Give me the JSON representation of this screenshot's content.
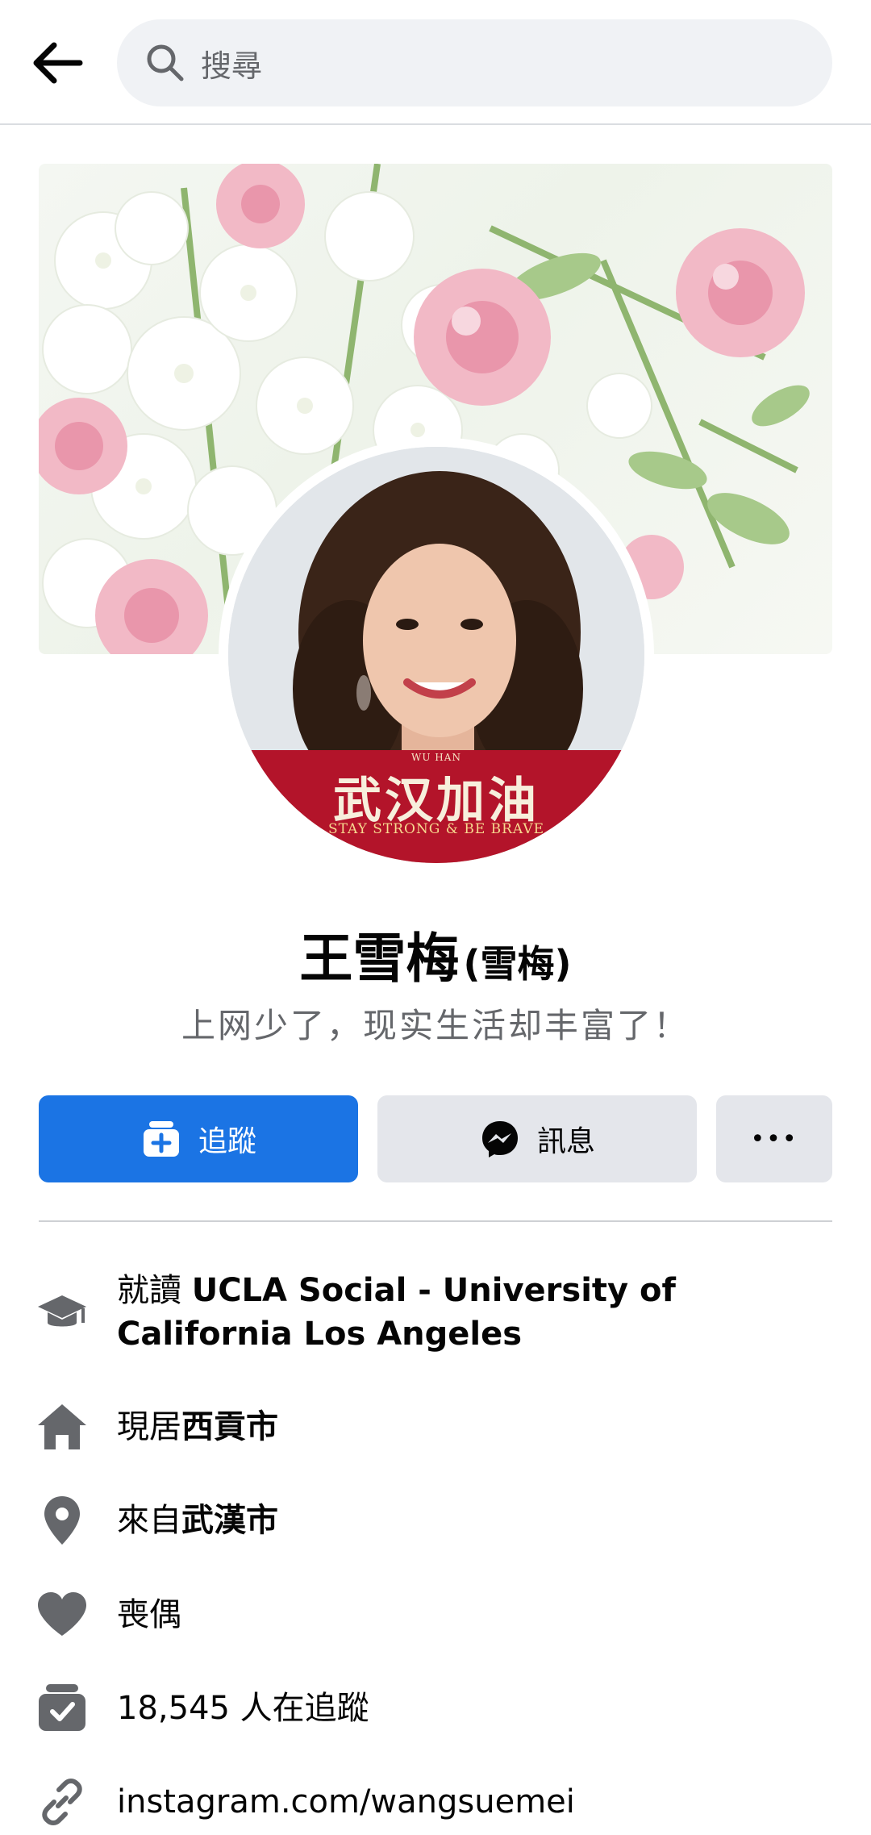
{
  "search": {
    "placeholder": "搜尋"
  },
  "profile": {
    "name": "王雪梅",
    "alt_name": "(雪梅)",
    "bio": "上网少了，现实生活却丰富了！",
    "avatar_banner": {
      "top": "WU HAN",
      "main": "武汉加油",
      "sub": "STAY STRONG & BE BRAVE"
    }
  },
  "actions": {
    "follow_label": "追蹤",
    "message_label": "訊息",
    "more_label": "•••"
  },
  "intro": [
    {
      "icon": "graduation-cap-icon",
      "prefix": "就讀",
      "bold": "UCLA Social - University of California Los Angeles"
    },
    {
      "icon": "home-icon",
      "prefix": "現居",
      "bold": "西貢市"
    },
    {
      "icon": "location-pin-icon",
      "prefix": "來自",
      "bold": "武漢市"
    },
    {
      "icon": "heart-icon",
      "prefix": "喪偶",
      "bold": ""
    },
    {
      "icon": "followers-icon",
      "prefix": "18,545 人在追蹤",
      "bold": ""
    },
    {
      "icon": "link-icon",
      "prefix": "instagram.com/wangsuemei",
      "bold": ""
    }
  ],
  "colors": {
    "accent": "#1b74e4",
    "secondary_button": "#e4e6eb",
    "search_bg": "#f0f2f5",
    "icon_gray": "#65676b"
  }
}
